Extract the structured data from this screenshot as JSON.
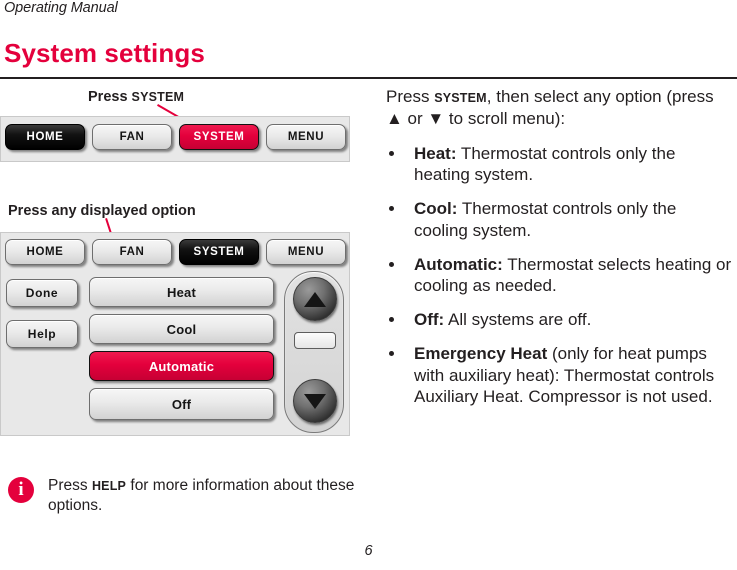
{
  "header": {
    "running_head": "Operating Manual",
    "page_title": "System settings",
    "page_number": "6",
    "accent_color": "#E4003C",
    "text_color": "#231F20"
  },
  "captions": {
    "press_system_prefix": "Press ",
    "press_system_key": "SYSTEM",
    "press_any_option": "Press any displayed option"
  },
  "device_1": {
    "nav": [
      {
        "label": "HOME",
        "state": "active-dark"
      },
      {
        "label": "FAN",
        "state": "normal"
      },
      {
        "label": "SYSTEM",
        "state": "highlight-red"
      },
      {
        "label": "MENU",
        "state": "normal"
      }
    ]
  },
  "device_2": {
    "nav": [
      {
        "label": "HOME",
        "state": "normal"
      },
      {
        "label": "FAN",
        "state": "normal"
      },
      {
        "label": "SYSTEM",
        "state": "active-dark"
      },
      {
        "label": "MENU",
        "state": "normal"
      }
    ],
    "side_buttons": [
      {
        "label": "Done"
      },
      {
        "label": "Help"
      }
    ],
    "options": [
      {
        "label": "Heat",
        "state": "normal"
      },
      {
        "label": "Cool",
        "state": "normal"
      },
      {
        "label": "Automatic",
        "state": "selected-red"
      },
      {
        "label": "Off",
        "state": "normal"
      }
    ],
    "scroll": {
      "up_icon": "triangle-up-icon",
      "down_icon": "triangle-down-icon"
    }
  },
  "body": {
    "intro_a": "Press ",
    "intro_key": "SYSTEM",
    "intro_b": ", then select any option (press ▲ or ▼ to scroll menu):",
    "bullets": [
      {
        "term": "Heat:",
        "text": " Thermostat controls only the heating system."
      },
      {
        "term": "Cool:",
        "text": " Thermostat controls only the cooling system."
      },
      {
        "term": "Automatic:",
        "text": " Thermostat selects heating or cooling as needed."
      },
      {
        "term": "Off:",
        "text": " All systems are off."
      },
      {
        "term": "Emergency Heat",
        "text": " (only for heat pumps with auxiliary heat): Thermostat controls Auxiliary Heat. Compressor is not used."
      }
    ]
  },
  "note": {
    "icon": "info-icon",
    "prefix": "Press ",
    "key": "HELP",
    "suffix": " for more information about these options."
  }
}
